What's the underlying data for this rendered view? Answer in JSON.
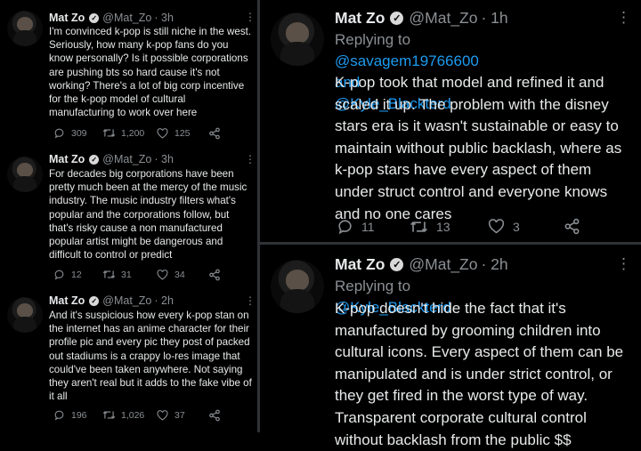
{
  "left": [
    {
      "name": "Mat Zo",
      "handle": "@Mat_Zo",
      "time": "· 3h",
      "text": "I'm convinced k-pop is still niche in the west. Seriously, how many k-pop fans do you know personally? Is it possible corporations are pushing bts so hard cause it's not working? There's a lot of big corp incentive for the k-pop model of cultural manufacturing to work over here",
      "replies": "309",
      "retweets": "1,200",
      "likes": "125"
    },
    {
      "name": "Mat Zo",
      "handle": "@Mat_Zo",
      "time": "· 3h",
      "text": "For decades big corporations have been pretty much been at the mercy of the music industry. The music industry filters what's popular and the corporations follow, but that's risky cause a non manufactured popular artist might be dangerous and difficult to control or predict",
      "replies": "12",
      "retweets": "31",
      "likes": "34"
    },
    {
      "name": "Mat Zo",
      "handle": "@Mat_Zo",
      "time": "· 2h",
      "text": "And it's suspicious how every k-pop stan on the internet has an anime character for their profile pic and every pic they post of packed out stadiums is a crappy lo-res image that could've been taken anywhere. Not saying they aren't real but it adds to the fake vibe of it all",
      "replies": "196",
      "retweets": "1,026",
      "likes": "37"
    }
  ],
  "right": [
    {
      "name": "Mat Zo",
      "handle": "@Mat_Zo",
      "time": "· 1h",
      "replying_label": "Replying to",
      "reply_users_line1": "@savagem19766600 and",
      "reply_users_line2": "@Kyle_Blackterd",
      "text": "K-pop took that model and refined it and scaled it up. The problem with the disney stars era is it wasn't sustainable or easy to maintain without public backlash, where as k-pop stars have every aspect of them under struct control and everyone knows and no one cares",
      "replies": "11",
      "retweets": "13",
      "likes": "3"
    },
    {
      "name": "Mat Zo",
      "handle": "@Mat_Zo",
      "time": "· 2h",
      "replying_label": "Replying to",
      "reply_users_line1": "@Kyle_Blackterd",
      "text": "K-pop doesn't hide the fact that it's manufactured by grooming children into cultural icons. Every aspect of them can be manipulated and is under strict control, or they get fired in the worst type of way. Transparent corporate cultural control without backlash from the public $$"
    }
  ],
  "verified_mark": "✓",
  "more_glyph": "⋮",
  "colors": {
    "link": "#1d9bf0",
    "muted": "#8b8f93",
    "text": "#e7e9ea",
    "divider": "#2f3336"
  },
  "icons": [
    "reply-icon",
    "retweet-icon",
    "like-icon",
    "share-icon",
    "verified-badge-icon",
    "more-icon"
  ]
}
